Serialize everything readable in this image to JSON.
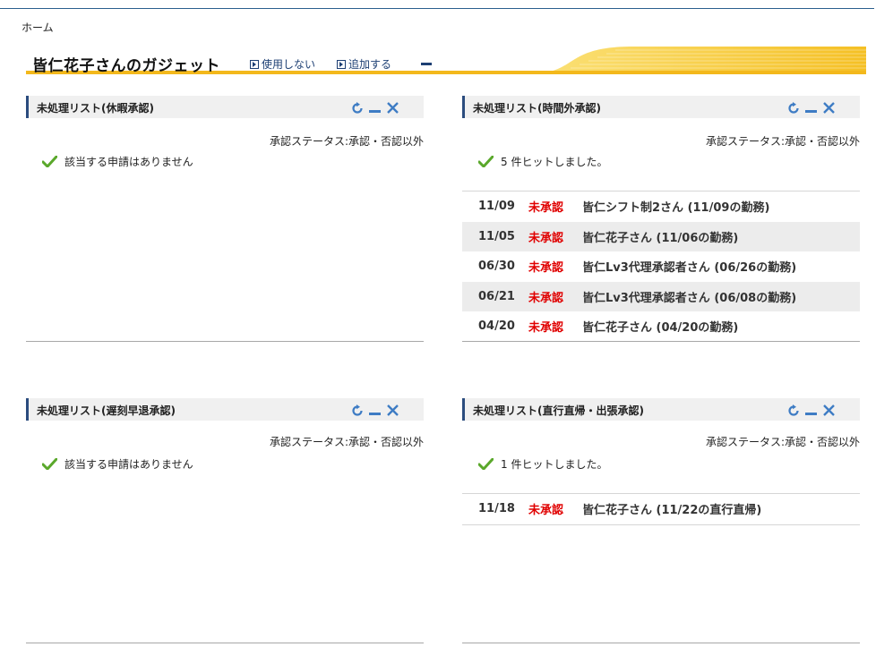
{
  "breadcrumb": "ホーム",
  "header": {
    "title": "皆仁花子さんのガジェット",
    "unused_link": "使用しない",
    "add_link": "追加する"
  },
  "colors": {
    "accent": "#f3b81c",
    "header_bar": "#2b4c7e",
    "unapproved": "#e00000"
  },
  "gadgets": [
    {
      "title": "未処理リスト(休暇承認)",
      "status": "承認ステータス:承認・否認以外",
      "message": "該当する申請はありません",
      "rows": []
    },
    {
      "title": "未処理リスト(時間外承認)",
      "status": "承認ステータス:承認・否認以外",
      "message": "5 件ヒットしました。",
      "rows": [
        {
          "date": "11/09",
          "state": "未承認",
          "who": "皆仁シフト制2さん (11/09の勤務)"
        },
        {
          "date": "11/05",
          "state": "未承認",
          "who": "皆仁花子さん (11/06の勤務)"
        },
        {
          "date": "06/30",
          "state": "未承認",
          "who": "皆仁Lv3代理承認者さん (06/26の勤務)"
        },
        {
          "date": "06/21",
          "state": "未承認",
          "who": "皆仁Lv3代理承認者さん (06/08の勤務)"
        },
        {
          "date": "04/20",
          "state": "未承認",
          "who": "皆仁花子さん (04/20の勤務)"
        }
      ]
    },
    {
      "title": "未処理リスト(遅刻早退承認)",
      "status": "承認ステータス:承認・否認以外",
      "message": "該当する申請はありません",
      "rows": []
    },
    {
      "title": "未処理リスト(直行直帰・出張承認)",
      "status": "承認ステータス:承認・否認以外",
      "message": "1 件ヒットしました。",
      "rows": [
        {
          "date": "11/18",
          "state": "未承認",
          "who": "皆仁花子さん (11/22の直行直帰)"
        }
      ]
    }
  ]
}
